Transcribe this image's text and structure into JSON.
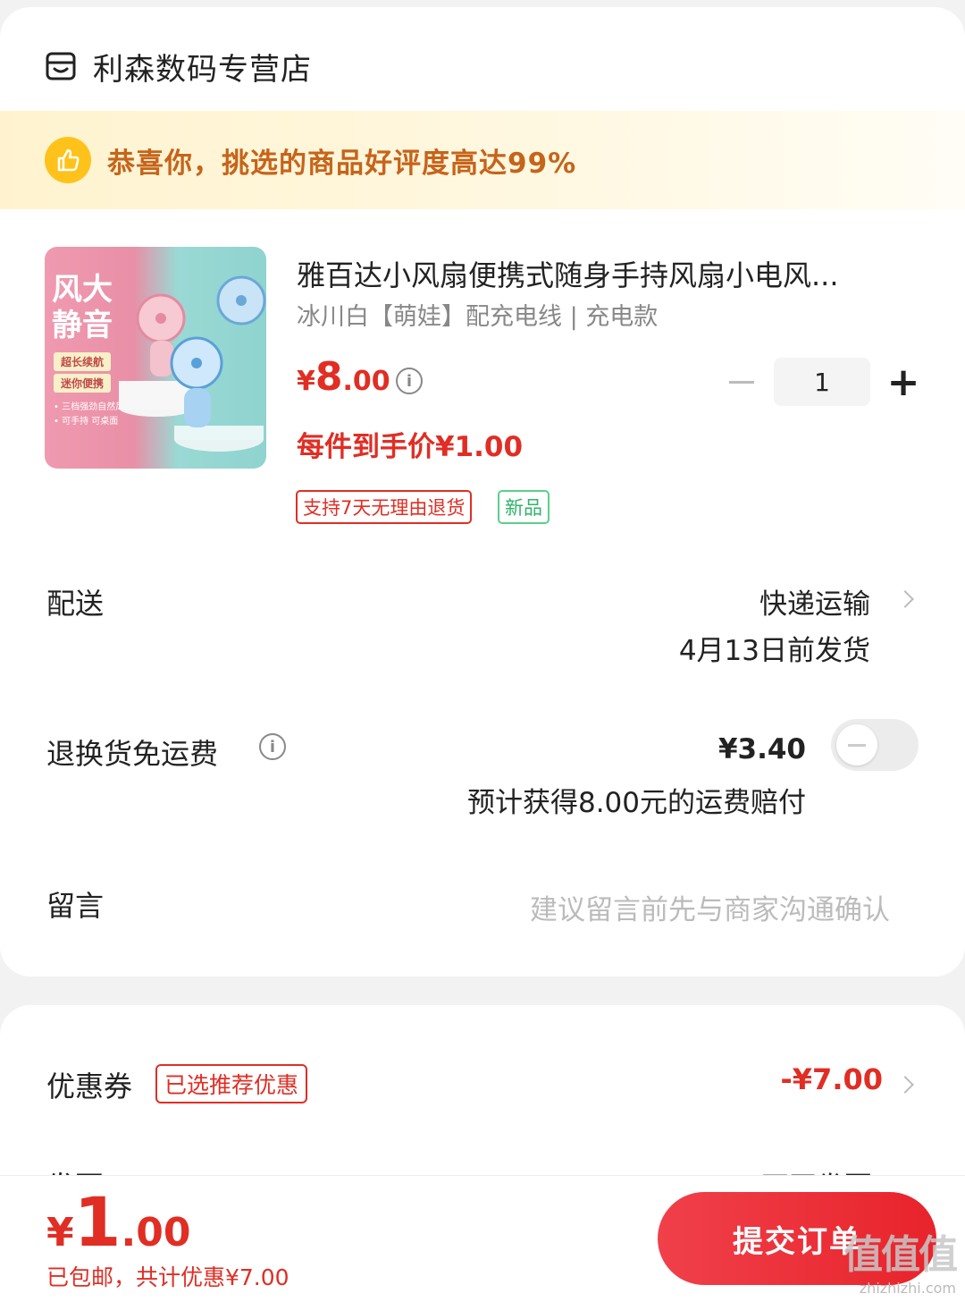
{
  "shop": {
    "name": "利森数码专营店",
    "icon": "shop-icon"
  },
  "banner": {
    "text": "恭喜你，挑选的商品好评度高达99%",
    "icon": "thumbs-up-icon"
  },
  "product": {
    "image_title": "风大静音",
    "image_tags": [
      "超长续航",
      "迷你便携"
    ],
    "image_small": [
      "• 三档强劲自然风",
      "• 可手持 可桌面"
    ],
    "title": "雅百达小风扇便携式随身手持风扇小电风...",
    "spec": "冰川白【萌娃】配充电线 | 充电款",
    "price_currency": "¥",
    "price_int": "8",
    "price_dec": ".00",
    "unit_price": "每件到手价¥1.00",
    "quantity": "1",
    "tag_return": "支持7天无理由退货",
    "tag_new": "新品"
  },
  "delivery": {
    "label": "配送",
    "method": "快递运输",
    "date": "4月13日前发货"
  },
  "insurance": {
    "label": "退换货免运费",
    "price": "¥3.40",
    "note": "预计获得8.00元的运费赔付",
    "enabled": false
  },
  "message": {
    "label": "留言",
    "placeholder": "建议留言前先与商家沟通确认"
  },
  "coupon": {
    "label": "优惠券",
    "tag": "已选推荐优惠",
    "value": "-¥7.00"
  },
  "invoice": {
    "label": "发票",
    "value": "不开发票"
  },
  "footer": {
    "currency": "¥",
    "total_int": "1",
    "total_dec": ".00",
    "sub": "已包邮，共计优惠¥7.00",
    "submit": "提交订单"
  },
  "watermark": {
    "big": "值值值",
    "small": "zhizhizhi.com"
  },
  "colors": {
    "accent": "#e02e24",
    "banner_text": "#c6641a",
    "green": "#2fb36b"
  }
}
